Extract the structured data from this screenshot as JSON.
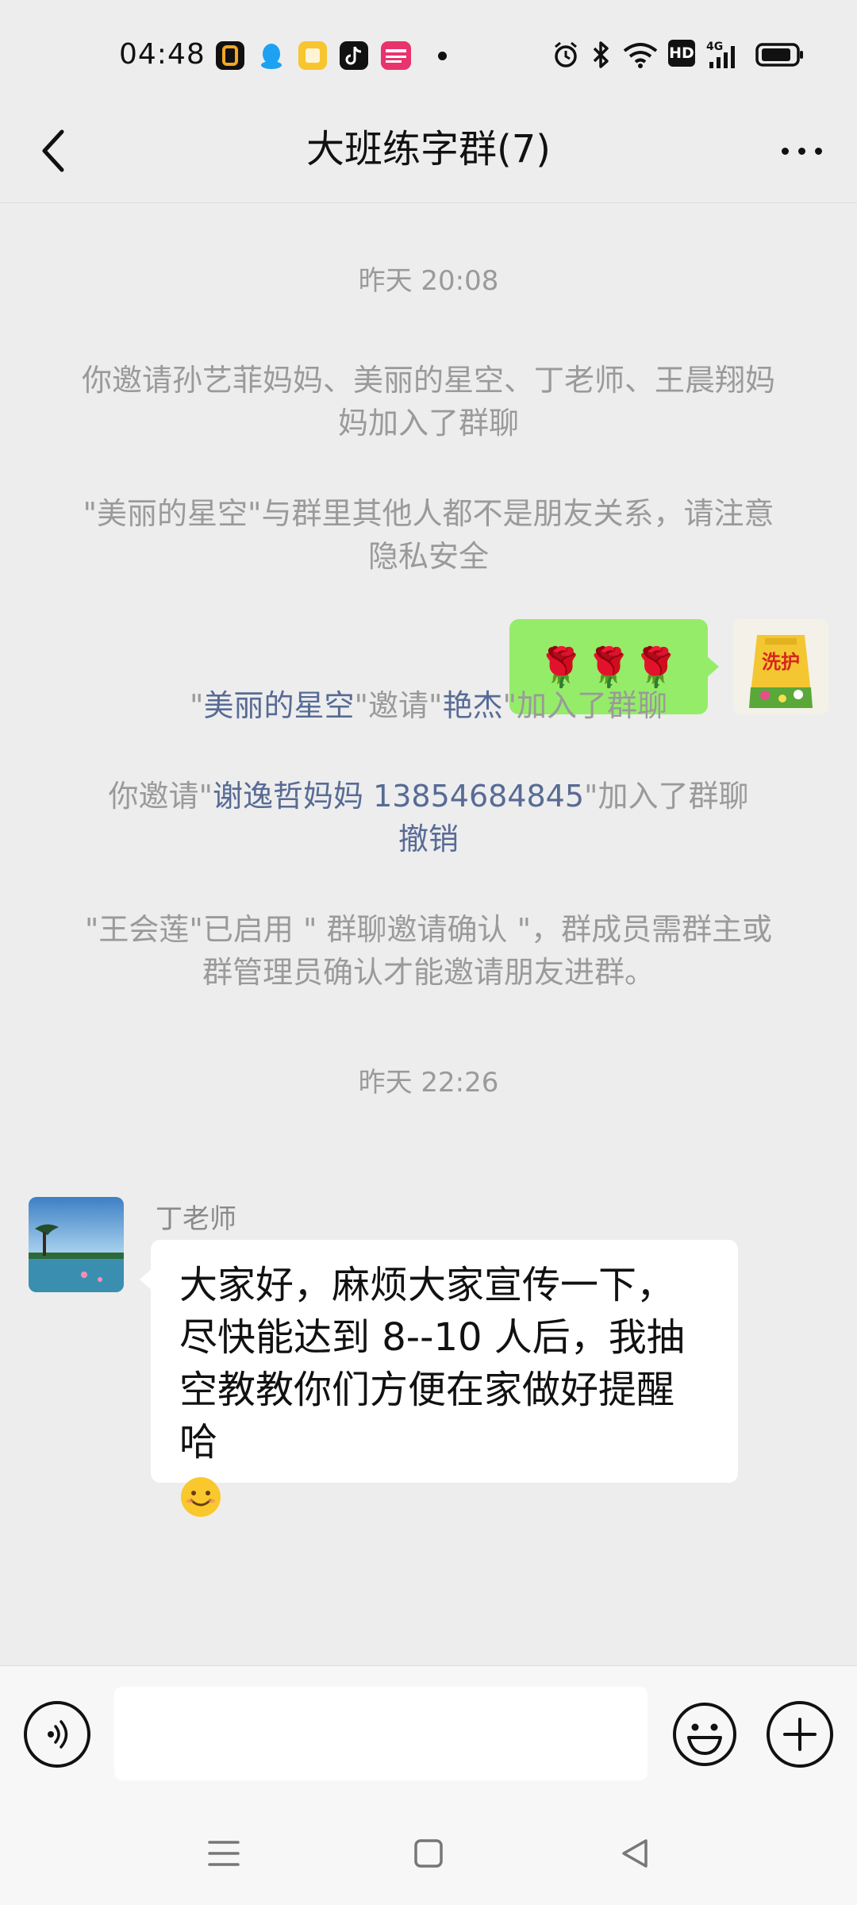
{
  "status_bar": {
    "time": "04:48",
    "icons_left": [
      "app-o-icon",
      "qq-icon",
      "notes-icon",
      "tiktok-icon",
      "store-icon",
      "dot-icon"
    ],
    "icons_right": [
      "alarm-icon",
      "bluetooth-icon",
      "wifi-icon",
      "hd-icon",
      "signal-4g-icon",
      "battery-icon"
    ],
    "hd_label": "HD",
    "net_label": "4G"
  },
  "header": {
    "title": "大班练字群(7)"
  },
  "messages": {
    "ts1": "昨天 20:08",
    "sys1": "你邀请孙艺菲妈妈、美丽的星空、丁老师、王晨翔妈妈加入了群聊",
    "sys2": "\"美丽的星空\"与群里其他人都不是朋友关系，请注意隐私安全",
    "self_bubble": "🌹🌹🌹",
    "sys3": {
      "q1": "\"",
      "name1": "美丽的星空",
      "mid": "\"邀请\"",
      "name2": "艳杰",
      "end": "\"加入了群聊"
    },
    "sys4": {
      "pre": "你邀请\"",
      "name": "谢逸哲妈妈 13854684845",
      "end": "\"加入了群聊",
      "undo": "撤销"
    },
    "sys5": "\"王会莲\"已启用 \" 群聊邀请确认 \"，群成员需群主或群管理员确认才能邀请朋友进群。",
    "ts2": "昨天 22:26",
    "other_sender": "丁老师",
    "other_text": "大家好，麻烦大家宣传一下，尽快能达到 8--10 人后，我抽空教教你们方便在家做好提醒哈",
    "other_emoji": "😊"
  },
  "colors": {
    "background": "#ededed",
    "self_bubble": "#95ec69",
    "link": "#576b95",
    "system_text": "#9a9a9a"
  }
}
